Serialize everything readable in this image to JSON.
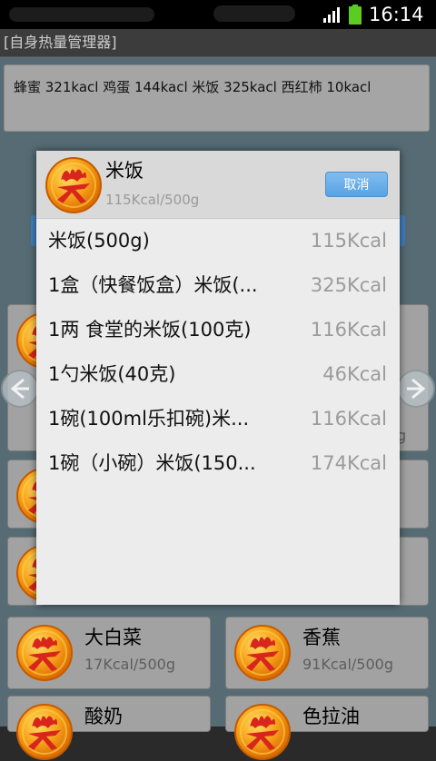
{
  "status_bar": {
    "time": "16:14"
  },
  "app": {
    "title": "[自身热量管理器]"
  },
  "summary": {
    "text": "蜂蜜 321kacl  鸡蛋 144kacl  米饭 325kacl  西红柿 10kacl"
  },
  "dialog": {
    "title": "米饭",
    "subtitle": "115Kcal/500g",
    "cancel_label": "取消",
    "items": [
      {
        "name": "米饭(500g)",
        "kcal": "115Kcal"
      },
      {
        "name": "1盒（快餐饭盒）米饭(...",
        "kcal": "325Kcal"
      },
      {
        "name": "1两 食堂的米饭(100克)",
        "kcal": "116Kcal"
      },
      {
        "name": "1勺米饭(40克)",
        "kcal": "46Kcal"
      },
      {
        "name": "1碗(100ml乐扣碗)米...",
        "kcal": "116Kcal"
      },
      {
        "name": "1碗（小碗）米饭(150...",
        "kcal": "174Kcal"
      }
    ]
  },
  "grid": {
    "peek_right": "g",
    "tiles": [
      {
        "name": "大白菜",
        "kcal": "17Kcal/500g"
      },
      {
        "name": "香蕉",
        "kcal": "91Kcal/500g"
      },
      {
        "name": "酸奶",
        "kcal": ""
      },
      {
        "name": "色拉油",
        "kcal": ""
      }
    ]
  },
  "icons": {
    "logo": "fire-logo-icon",
    "prev": "arrow-left-icon",
    "next": "arrow-right-icon"
  },
  "colors": {
    "accent": "#5aa2e2",
    "logo_orange": "#f39c12"
  }
}
